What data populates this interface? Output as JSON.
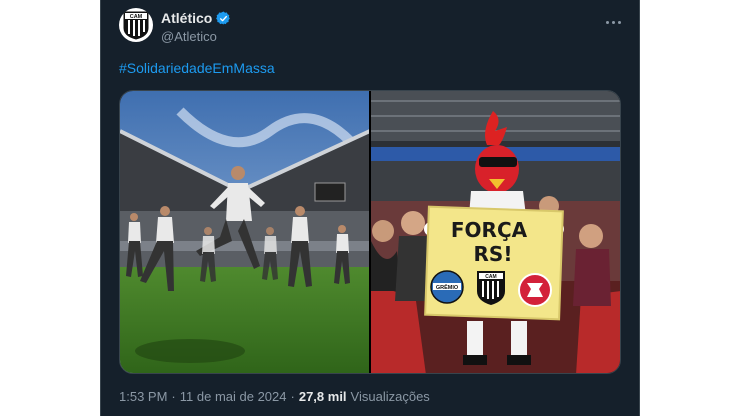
{
  "account": {
    "display_name": "Atlético",
    "handle": "@Atletico",
    "avatar_text": "CAM"
  },
  "tweet": {
    "hashtag": "#SolidariedadeEmMassa",
    "time": "1:53 PM",
    "separator": "·",
    "date": "11 de mai de 2024",
    "views_count": "27,8 mil",
    "views_label": "Visualizações"
  },
  "media": {
    "sign_line1": "FORÇA",
    "sign_line2": "RS!",
    "crest_left": "GRÊMIO",
    "crest_center": "CAM"
  },
  "colors": {
    "background": "#15202b",
    "link": "#1d9bf0",
    "verified": "#1d9bf0",
    "secondary_text": "#8b98a5"
  }
}
